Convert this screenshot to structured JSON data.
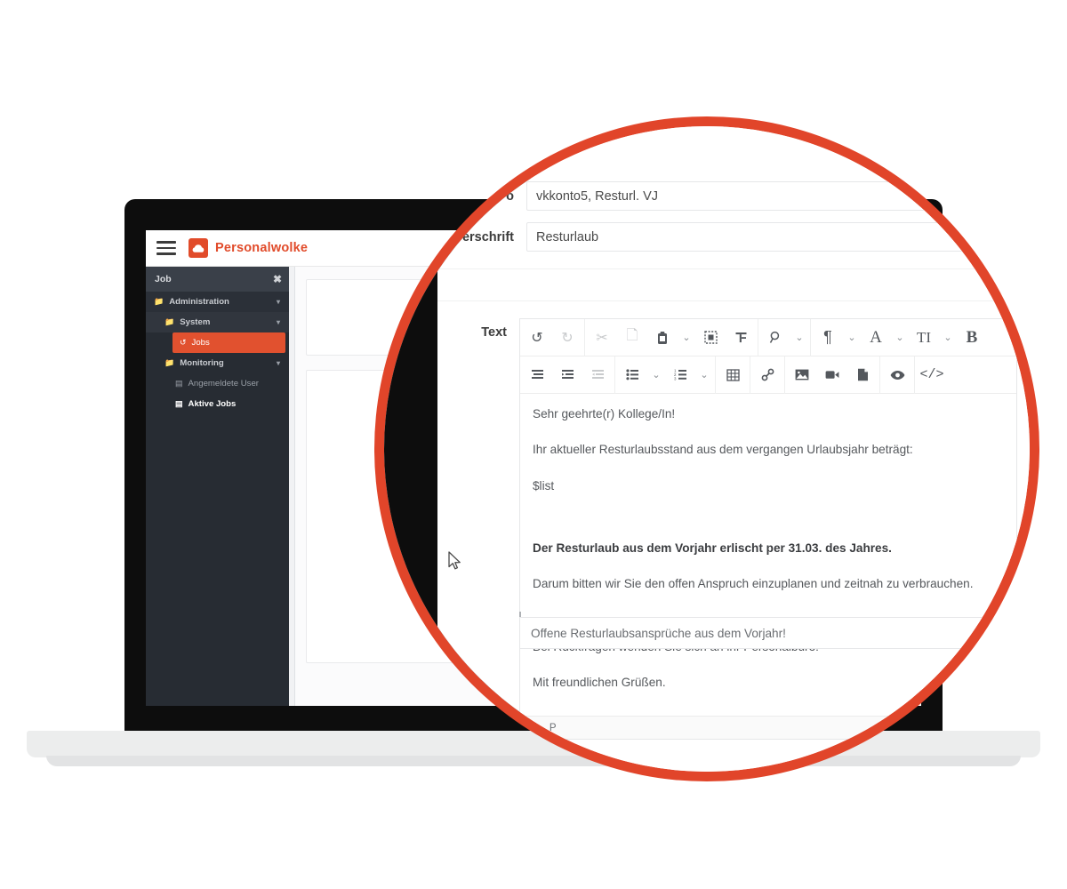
{
  "app": {
    "brand": "Personalwolke",
    "logo_icon": "cloud-icon",
    "menu_icon": "hamburger-menu-icon",
    "accent_color": "#e14b2a",
    "sidebar_bg": "#272c33",
    "highlight_color": "#e1512f"
  },
  "sidebar": {
    "search": {
      "value": "Job",
      "placeholder": "Job",
      "close_icon": "close-icon"
    },
    "items": [
      {
        "label": "Administration",
        "icon": "folder-icon",
        "level": 1,
        "selected": false,
        "caret": "chevron-down-icon"
      },
      {
        "label": "System",
        "icon": "folder-icon",
        "level": 2,
        "selected": false,
        "caret": "chevron-down-icon"
      },
      {
        "label": "Jobs",
        "icon": "history-icon",
        "level": 3,
        "selected": true,
        "caret": ""
      },
      {
        "label": "Monitoring",
        "icon": "folder-icon",
        "level": 2,
        "selected": false,
        "caret": "chevron-down-icon"
      },
      {
        "label": "Angemeldete User",
        "icon": "table-icon",
        "level": 3,
        "selected": false,
        "caret": ""
      },
      {
        "label": "Aktive Jobs",
        "icon": "table-icon",
        "level": 3,
        "selected": false,
        "caret": ""
      }
    ]
  },
  "form": {
    "fields": [
      {
        "label": "Info",
        "label_visible": "o",
        "value": "vkkonto5, Resturl. VJ"
      },
      {
        "label": "Überschrift",
        "label_visible": "erschrift",
        "value": "Resturlaub"
      },
      {
        "label": "Text",
        "label_visible": "Text",
        "value": ""
      }
    ],
    "footer_input": {
      "value": "Offene Resturlaubsansprüche aus dem Vorjahr!"
    }
  },
  "editor": {
    "toolbar_row1": [
      {
        "name": "undo-icon",
        "glyph": "↺",
        "disabled": false,
        "dropdown": false
      },
      {
        "name": "redo-icon",
        "glyph": "↻",
        "disabled": true,
        "dropdown": false
      },
      {
        "name": "cut-icon",
        "glyph": "✂",
        "disabled": true,
        "dropdown": false
      },
      {
        "name": "copy-icon",
        "glyph": "⎘",
        "disabled": true,
        "dropdown": false
      },
      {
        "name": "paste-icon",
        "glyph": "📋",
        "disabled": false,
        "dropdown": true
      },
      {
        "name": "select-all-icon",
        "glyph": "⬚",
        "disabled": false,
        "dropdown": false
      },
      {
        "name": "clear-formatting-icon",
        "glyph": "⊤",
        "disabled": false,
        "dropdown": false
      },
      {
        "name": "search-icon",
        "glyph": "🔍",
        "disabled": false,
        "dropdown": true
      },
      {
        "name": "paragraph-format-icon",
        "glyph": "¶",
        "disabled": false,
        "dropdown": true
      },
      {
        "name": "font-family-icon",
        "glyph": "A",
        "disabled": false,
        "dropdown": true
      },
      {
        "name": "font-size-icon",
        "glyph": "TI",
        "disabled": false,
        "dropdown": true
      },
      {
        "name": "bold-icon",
        "glyph": "B",
        "disabled": false,
        "dropdown": false
      }
    ],
    "toolbar_row2": [
      {
        "name": "align-icon",
        "glyph": "≡",
        "disabled": false,
        "dropdown": false
      },
      {
        "name": "indent-icon",
        "glyph": "⇥",
        "disabled": false,
        "dropdown": false
      },
      {
        "name": "outdent-icon",
        "glyph": "⇤",
        "disabled": true,
        "dropdown": false
      },
      {
        "name": "unordered-list-icon",
        "glyph": "•≡",
        "disabled": false,
        "dropdown": true
      },
      {
        "name": "ordered-list-icon",
        "glyph": "1≡",
        "disabled": false,
        "dropdown": true
      },
      {
        "name": "table-icon",
        "glyph": "▦",
        "disabled": false,
        "dropdown": false
      },
      {
        "name": "link-icon",
        "glyph": "🔗",
        "disabled": false,
        "dropdown": false
      },
      {
        "name": "insert-image-icon",
        "glyph": "🖼",
        "disabled": false,
        "dropdown": false
      },
      {
        "name": "insert-video-icon",
        "glyph": "🎥",
        "disabled": false,
        "dropdown": false
      },
      {
        "name": "insert-file-icon",
        "glyph": "📄",
        "disabled": false,
        "dropdown": false
      },
      {
        "name": "preview-icon",
        "glyph": "👁",
        "disabled": false,
        "dropdown": false
      },
      {
        "name": "code-view-icon",
        "glyph": "</>",
        "disabled": false,
        "dropdown": false
      }
    ],
    "content": [
      {
        "text": "Sehr geehrte(r) Kollege/In!",
        "bold": false,
        "gap": false
      },
      {
        "text": "Ihr aktueller Resturlaubsstand aus dem vergangen Urlaubsjahr beträgt:",
        "bold": false,
        "gap": false
      },
      {
        "text": "$list",
        "bold": false,
        "gap": true
      },
      {
        "text": "Der Resturlaub aus dem Vorjahr erlischt per 31.03. des Jahres.",
        "bold": true,
        "gap": false
      },
      {
        "text": "Darum bitten wir Sie den offen Anspruch einzuplanen und zeitnah zu verbrauchen.",
        "bold": false,
        "gap": true
      },
      {
        "text": "Bei Rückfragen wenden Sie sich an ihr Personalbüro!",
        "bold": false,
        "gap": false
      },
      {
        "text": "Mit freundlichen Grüßen.",
        "bold": false,
        "gap": false
      }
    ],
    "statusbar": {
      "icon": "element-path-icon",
      "path": "P"
    }
  },
  "magnifier": {
    "ring_color": "#e1452a",
    "cursor_icon": "mouse-pointer-icon"
  }
}
